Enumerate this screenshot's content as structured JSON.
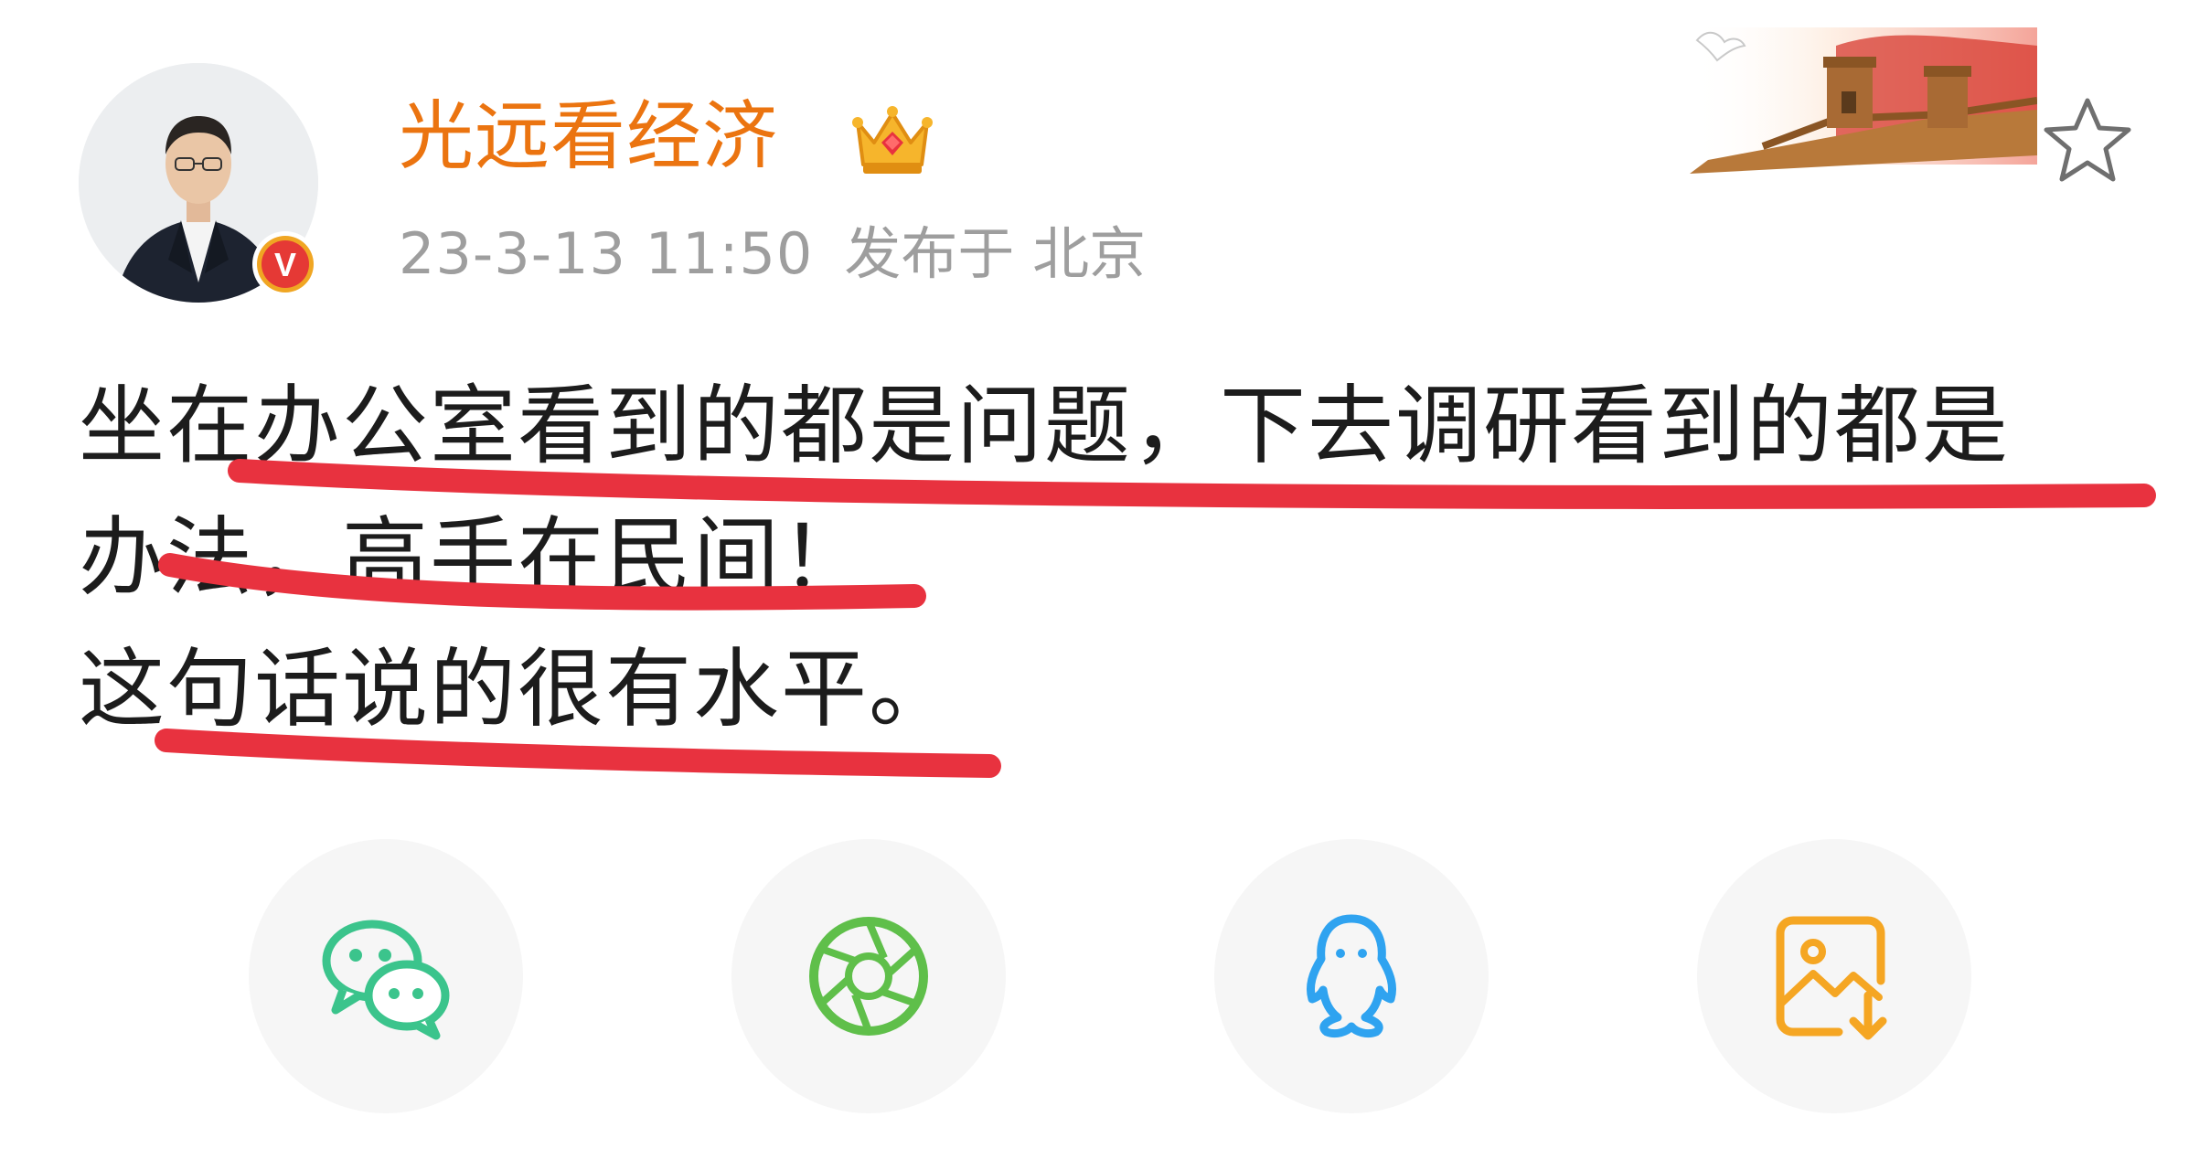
{
  "post": {
    "author": {
      "name": "光远看经济",
      "verified_badge_letter": "V",
      "avatar_icon": "avatar-photo",
      "member_icon": "crown-icon"
    },
    "timestamp": "23-3-13 11:50",
    "location": "发布于 北京",
    "text_lines": [
      "坐在办公室看到的都是问题，下去调研看到的都是",
      "办法，高手在民间！",
      "这句话说的很有水平。"
    ],
    "favorite_icon": "star-outline-icon",
    "banner_icon": "great-wall-banner"
  },
  "share": {
    "buttons": [
      {
        "name": "wechat",
        "icon": "wechat-icon",
        "color": "#3bc48c"
      },
      {
        "name": "moments",
        "icon": "moments-shutter-icon",
        "color": "#5fbf4a"
      },
      {
        "name": "qq",
        "icon": "qq-penguin-icon",
        "color": "#2fa3f0"
      },
      {
        "name": "save-image",
        "icon": "save-image-icon",
        "color": "#f5a623"
      }
    ]
  },
  "colors": {
    "username": "#eb7410",
    "meta": "#9e9e9e",
    "text": "#1c1c1c",
    "annotation_red": "#e8323f",
    "button_bg": "#f6f6f6"
  }
}
